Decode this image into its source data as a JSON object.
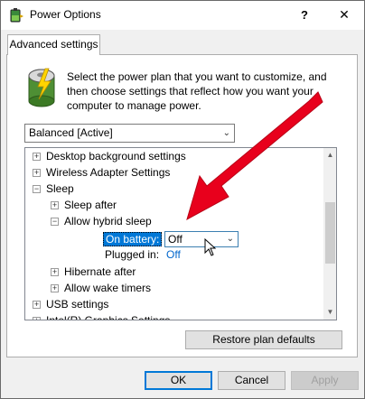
{
  "window": {
    "title": "Power Options",
    "help_glyph": "?",
    "close_glyph": "✕"
  },
  "tab": {
    "label": "Advanced settings"
  },
  "description": "Select the power plan that you want to customize, and then choose settings that reflect how you want your computer to manage power.",
  "plan_select": {
    "value": "Balanced [Active]"
  },
  "tree": {
    "items": [
      {
        "label": "Desktop background settings",
        "expander": "+"
      },
      {
        "label": "Wireless Adapter Settings",
        "expander": "+"
      },
      {
        "label": "Sleep",
        "expander": "−"
      },
      {
        "label": "Sleep after",
        "expander": "+"
      },
      {
        "label": "Allow hybrid sleep",
        "expander": "−"
      },
      {
        "label": "Hibernate after",
        "expander": "+"
      },
      {
        "label": "Allow wake timers",
        "expander": "+"
      },
      {
        "label": "USB settings",
        "expander": "+"
      },
      {
        "label": "Intel(R) Graphics Settings",
        "expander": "+"
      }
    ],
    "on_battery": {
      "label": "On battery:",
      "value": "Off"
    },
    "plugged_in": {
      "label": "Plugged in:",
      "value": "Off"
    }
  },
  "buttons": {
    "restore": "Restore plan defaults",
    "ok": "OK",
    "cancel": "Cancel",
    "apply": "Apply"
  },
  "colors": {
    "accent": "#0078d7",
    "arrow": "#e8001c"
  }
}
